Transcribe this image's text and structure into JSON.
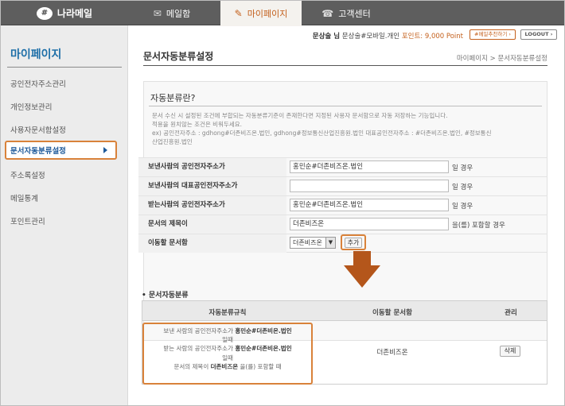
{
  "nav": {
    "logo_mark": "#",
    "logo": "나라메일",
    "tabs": [
      {
        "label": "메일함",
        "icon": "envelope-icon"
      },
      {
        "label": "마이페이지",
        "icon": "pencil-icon"
      },
      {
        "label": "고객센터",
        "icon": "phone-icon"
      }
    ]
  },
  "userbar": {
    "name": "문상술 님",
    "account": "문상술#모바일.개인",
    "points_label": "포인트:",
    "points": "9,000 Point",
    "recommend": "#메일추천하기 ›",
    "logout": "LOGOUT ›"
  },
  "sidebar": {
    "title": "마이페이지",
    "items": [
      {
        "label": "공인전자주소관리"
      },
      {
        "label": "개인정보관리"
      },
      {
        "label": "사용자문서함설정"
      },
      {
        "label": "문서자동분류설정"
      },
      {
        "label": "주소록설정"
      },
      {
        "label": "메일통계"
      },
      {
        "label": "포인트관리"
      }
    ]
  },
  "page": {
    "title": "문서자동분류설정",
    "breadcrumb": "마이페이지 > 문서자동분류설정"
  },
  "explain": {
    "heading": "자동분류란?",
    "line1": "문서 수신 시 설정된 조건에 부합되는 자동분류기준이 존재한다면 지정된 사용자 문서함으로 자동 저장하는 기능입니다.",
    "line2": "적용을 원치않는 조건은 비워두세요.",
    "line3": "ex) 공인전자주소 : gdhong#더존비즈온.법인, gdhong#정보통신산업진흥원.법인     대표공인전자주소 : #더존비즈온.법인, #정보통신",
    "line4": "산업진흥원.법인"
  },
  "form": {
    "rows": [
      {
        "label": "보낸사람의 공인전자주소가",
        "value": "홍민순#더존비즈온.법인",
        "suffix": "일 경우"
      },
      {
        "label": "보낸사람의 대표공인전자주소가",
        "value": "",
        "suffix": "일 경우"
      },
      {
        "label": "받는사람의 공인전자주소가",
        "value": "홍민순#더존비즈온.법인",
        "suffix": "일 경우"
      },
      {
        "label": "문서의 제목이",
        "value": "더존비즈온",
        "suffix": "을(를) 포함할 경우"
      }
    ],
    "folder_label": "이동할 문서함",
    "folder_value": "더존비즈온",
    "add_button": "추가"
  },
  "rules": {
    "section_title": "• 문서자동분류",
    "headers": [
      "자동분류규칙",
      "이동할 문서함",
      "관리"
    ],
    "row": {
      "l1a": "보낸 사람의 공인전자주소가 ",
      "l1b": "홍민순#더존비온.법인",
      "l2": "일때",
      "l3a": "받는 사람의 공인전자주소가 ",
      "l3b": "홍민순#더존비온.법인",
      "l4": "일때",
      "l5a": "문서의 제목이 ",
      "l5b": "더존비즈온",
      "l5c": " 을(를) 포함할 때",
      "folder": "더존비즈온",
      "delete": "삭제"
    }
  },
  "colors": {
    "accent": "#d9823a",
    "link": "#1e6fa8",
    "nav": "#5e5e5e"
  }
}
